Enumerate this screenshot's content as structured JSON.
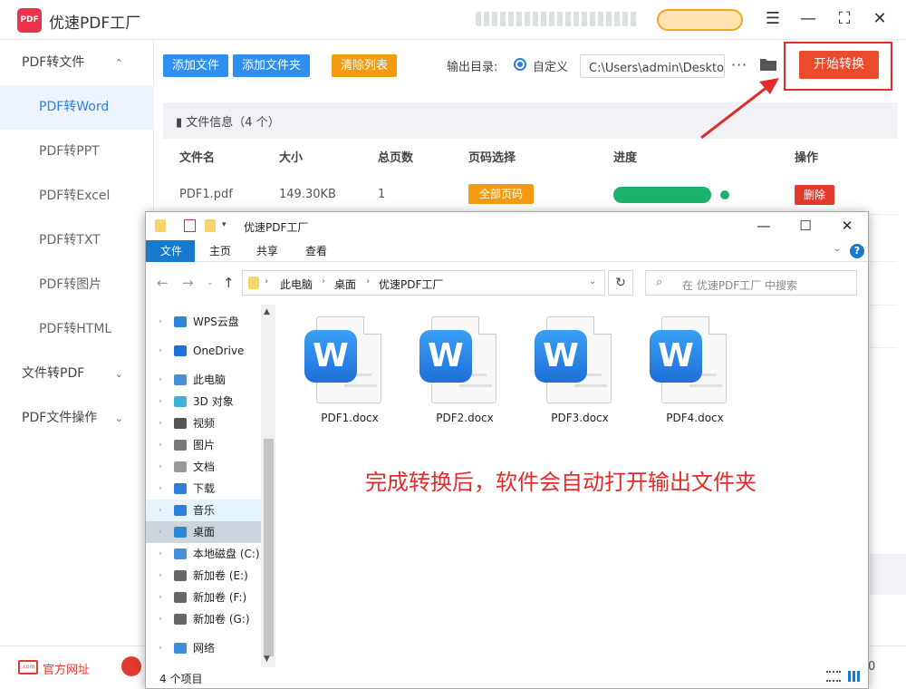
{
  "app": {
    "logo_text": "PDF",
    "title": "优速PDF工厂"
  },
  "window_controls": {
    "menu": "☰",
    "minimize": "—",
    "maximize": "⛶",
    "close": "✕"
  },
  "sidebar": {
    "groups": [
      {
        "label": "PDF转文件",
        "chevron": "⌃"
      },
      {
        "label": "文件转PDF",
        "chevron": "⌄"
      },
      {
        "label": "PDF文件操作",
        "chevron": "⌄"
      }
    ],
    "items": [
      {
        "label": "PDF转Word"
      },
      {
        "label": "PDF转PPT"
      },
      {
        "label": "PDF转Excel"
      },
      {
        "label": "PDF转TXT"
      },
      {
        "label": "PDF转图片"
      },
      {
        "label": "PDF转HTML"
      }
    ]
  },
  "footer": {
    "site_label": "官方网址",
    "site_icon_text": ".com",
    "version": "0"
  },
  "toolbar": {
    "add_file": "添加文件",
    "add_folder": "添加文件夹",
    "clear_list": "清除列表",
    "output_label": "输出目录:",
    "radio_label": "自定义",
    "path_value": "C:\\Users\\admin\\Deskto",
    "more": "···",
    "start": "开始转换"
  },
  "file_panel": {
    "info": "文件信息（4 个）",
    "columns": [
      "文件名",
      "大小",
      "总页数",
      "页码选择",
      "进度",
      "操作"
    ],
    "rows": [
      {
        "name": "PDF1.pdf",
        "size": "149.30KB",
        "pages": "1",
        "page_select": "全部页码",
        "progress": 1.0,
        "action": "删除"
      }
    ]
  },
  "explorer": {
    "title": "优速PDF工厂",
    "tabs": [
      "文件",
      "主页",
      "共享",
      "查看"
    ],
    "breadcrumb": [
      "此电脑",
      "桌面",
      "优速PDF工厂"
    ],
    "search_placeholder": "在 优速PDF工厂 中搜索",
    "tree": [
      {
        "label": "WPS云盘",
        "icon": "cloud-icon",
        "color": "#2b88d9"
      },
      {
        "label": "OneDrive",
        "icon": "onedrive-icon",
        "color": "#1a73d9"
      },
      {
        "label": "此电脑",
        "icon": "computer-icon",
        "color": "#4a90d9"
      },
      {
        "label": "3D 对象",
        "icon": "cube-icon",
        "color": "#3cb4d8"
      },
      {
        "label": "视频",
        "icon": "film-icon",
        "color": "#555555"
      },
      {
        "label": "图片",
        "icon": "picture-icon",
        "color": "#777777"
      },
      {
        "label": "文档",
        "icon": "document-icon",
        "color": "#999999"
      },
      {
        "label": "下载",
        "icon": "download-icon",
        "color": "#2b7fd9"
      },
      {
        "label": "音乐",
        "icon": "music-icon",
        "color": "#2b7fd9"
      },
      {
        "label": "桌面",
        "icon": "desktop-icon",
        "color": "#2b88d9"
      },
      {
        "label": "本地磁盘 (C:)",
        "icon": "drive-icon",
        "color": "#4a8fd9"
      },
      {
        "label": "新加卷 (E:)",
        "icon": "drive-icon",
        "color": "#666666"
      },
      {
        "label": "新加卷 (F:)",
        "icon": "drive-icon",
        "color": "#666666"
      },
      {
        "label": "新加卷 (G:)",
        "icon": "drive-icon",
        "color": "#666666"
      },
      {
        "label": "网络",
        "icon": "network-icon",
        "color": "#3a8fd9"
      }
    ],
    "files": [
      {
        "name": "PDF1.docx",
        "badge": "W"
      },
      {
        "name": "PDF2.docx",
        "badge": "W"
      },
      {
        "name": "PDF3.docx",
        "badge": "W"
      },
      {
        "name": "PDF4.docx",
        "badge": "W"
      }
    ],
    "status": "4 个项目"
  },
  "annotation": "完成转换后，软件会自动打开输出文件夹",
  "colors": {
    "accent": "#2f7fe0",
    "start": "#eb4b2d",
    "highlight": "#e22b2b",
    "progress": "#1bb26d"
  }
}
